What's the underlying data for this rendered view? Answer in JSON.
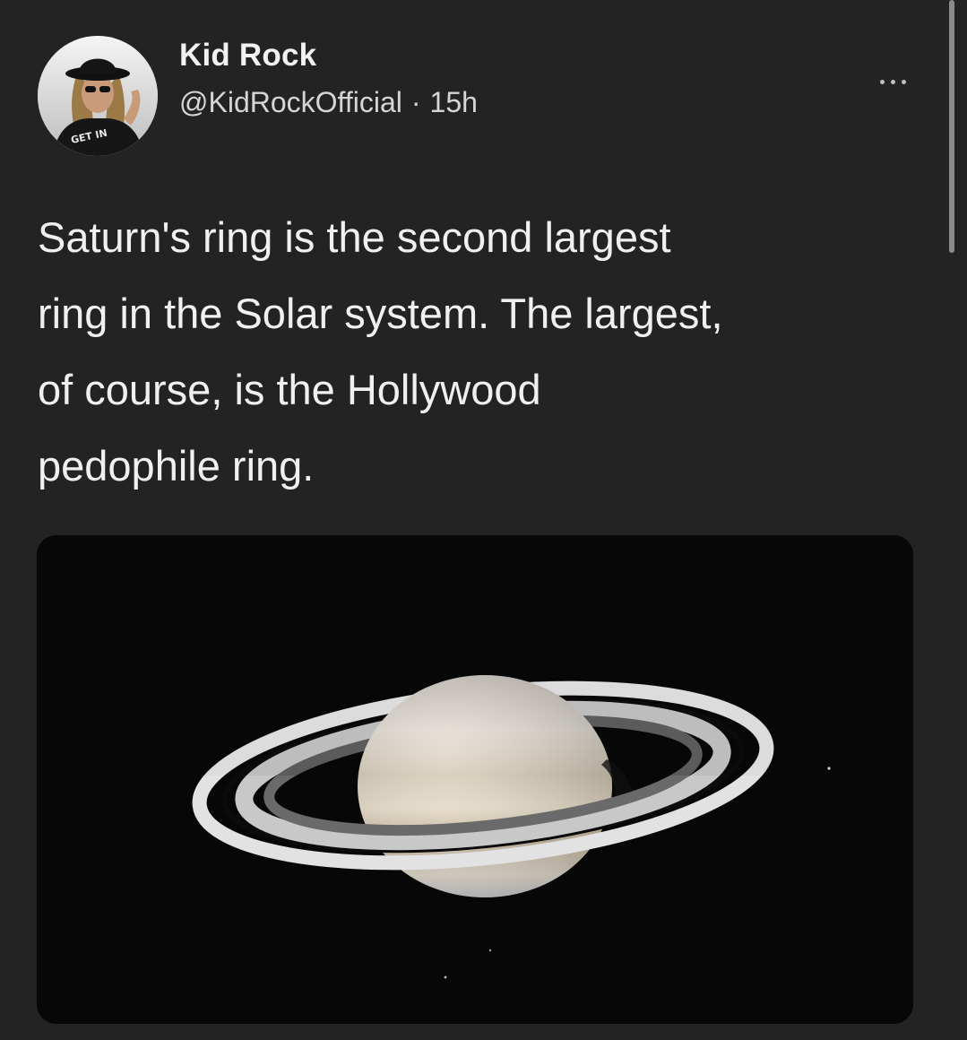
{
  "tweet": {
    "display_name": "Kid Rock",
    "handle": "@KidRockOfficial",
    "separator": "·",
    "time": "15h",
    "text": "Saturn's ring is the second largest\nring in the Solar system. The largest,\nof course, is the Hollywood\npedophile ring.",
    "more_icon": "ellipsis-icon",
    "media_subject": "saturn-image",
    "avatar_shirt_text": "GET IN"
  },
  "colors": {
    "background": "#232324",
    "text_primary": "#f0f0f0",
    "text_secondary": "#d6d6d6",
    "media_background": "#070707"
  }
}
